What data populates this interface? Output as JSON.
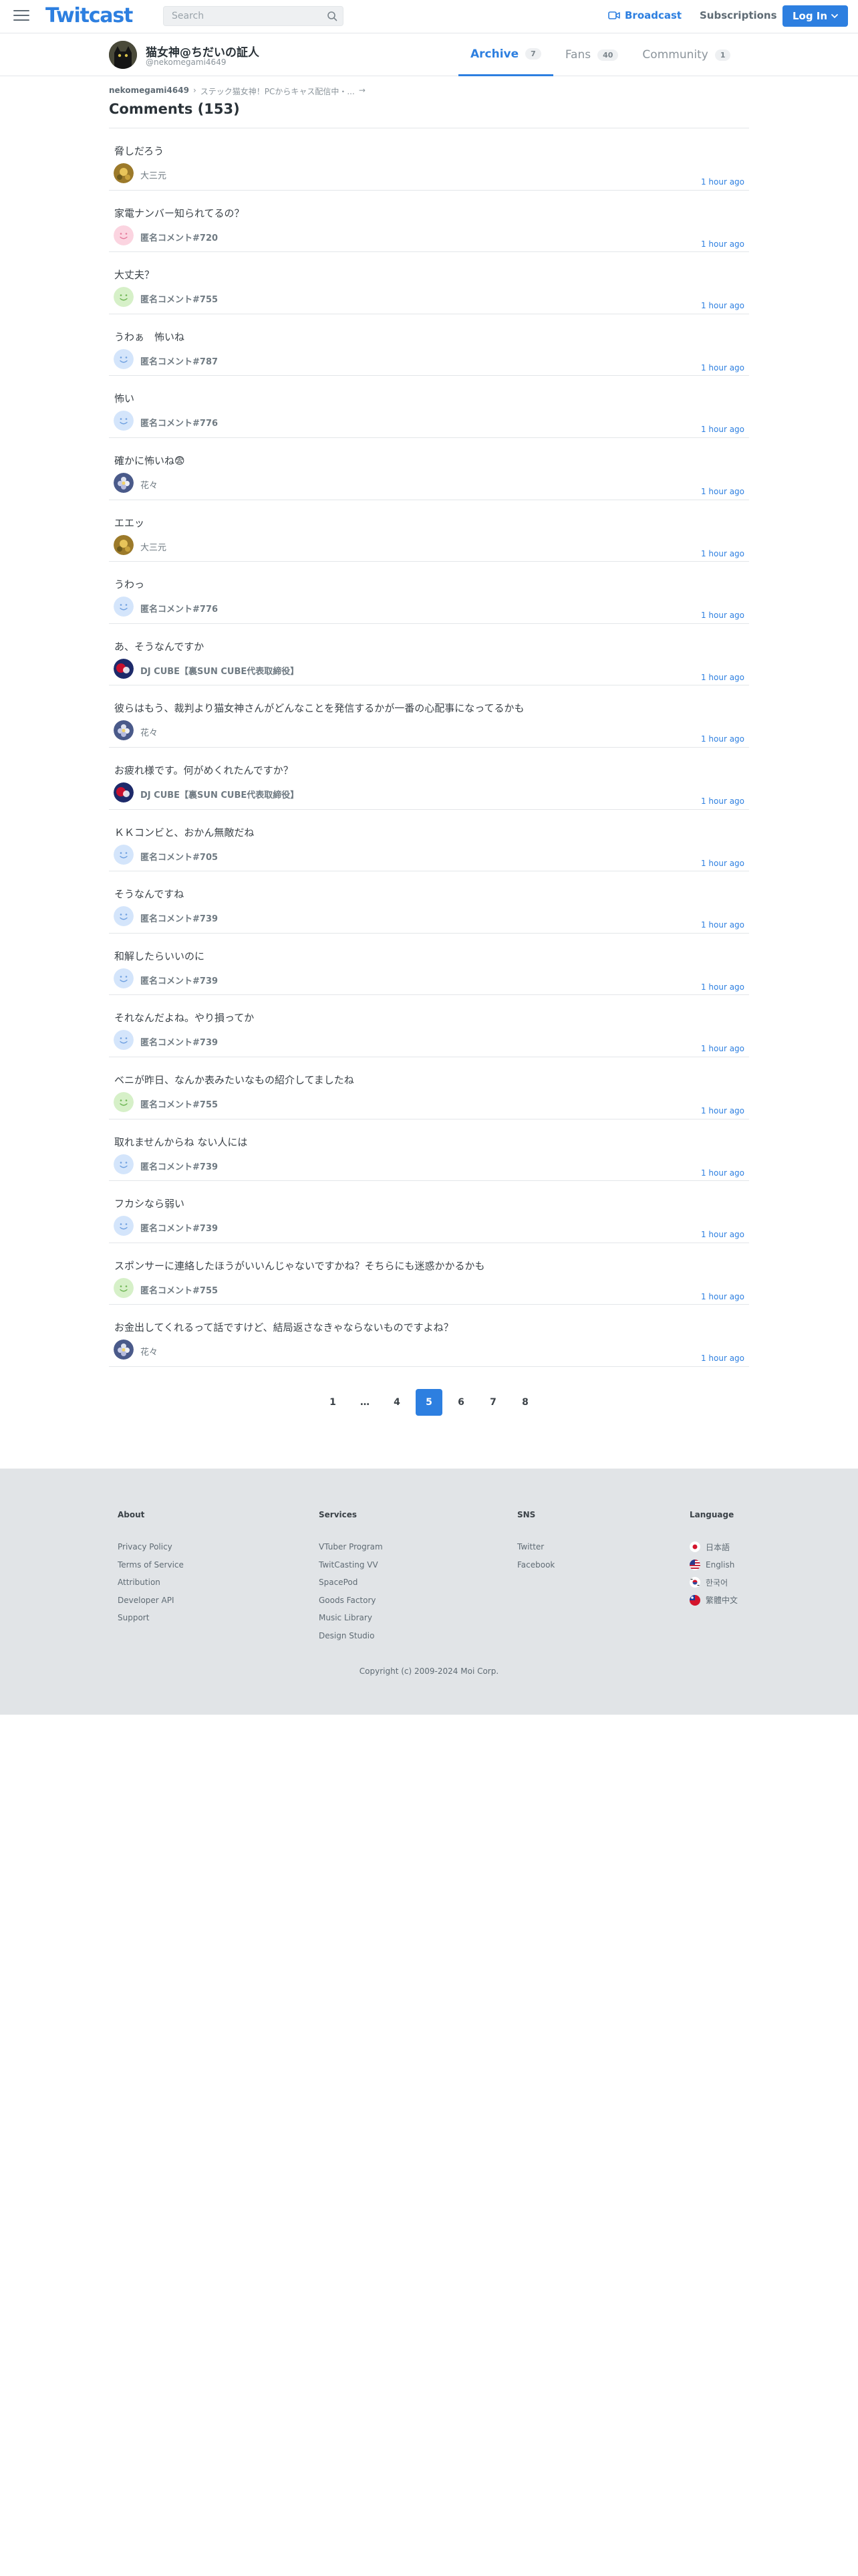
{
  "header": {
    "logo": "Twitcast",
    "search_placeholder": "Search",
    "broadcast_label": "Broadcast",
    "subscriptions_label": "Subscriptions",
    "login_label": "Log In"
  },
  "user": {
    "name": "猫女神@ちだいの証人",
    "id": "@nekomegami4649",
    "tabs": [
      {
        "label": "Archive",
        "count": "7",
        "active": true
      },
      {
        "label": "Fans",
        "count": "40",
        "active": false
      },
      {
        "label": "Community",
        "count": "1",
        "active": false
      }
    ]
  },
  "breadcrumb": {
    "first": "nekomegami4649",
    "second": "ステック猫女神！PCからキャス配信中・...",
    "sep": "›",
    "arrow": "→"
  },
  "heading": "Comments (153)",
  "comments": [
    {
      "text": "脅しだろう",
      "user": "大三元",
      "avatar": "gold",
      "time": "1 hour ago"
    },
    {
      "text": "家電ナンバー知られてるの？",
      "user": "匿名コメント#720",
      "avatar": "pink",
      "time": "1 hour ago"
    },
    {
      "text": "大丈夫？",
      "user": "匿名コメント#755",
      "avatar": "green",
      "time": "1 hour ago"
    },
    {
      "text": "うわぁ　怖いね",
      "user": "匿名コメント#787",
      "avatar": "blue",
      "time": "1 hour ago"
    },
    {
      "text": "怖い　",
      "user": "匿名コメント#776",
      "avatar": "blue",
      "time": "1 hour ago"
    },
    {
      "text": "確かに怖いね😨",
      "user": "花々",
      "avatar": "flower",
      "time": "1 hour ago"
    },
    {
      "text": "エエッ",
      "user": "大三元",
      "avatar": "gold",
      "time": "1 hour ago"
    },
    {
      "text": "うわっ　",
      "user": "匿名コメント#776",
      "avatar": "blue",
      "time": "1 hour ago"
    },
    {
      "text": "あ、そうなんですか",
      "user": "DJ CUBE【裏SUN CUBE代表取締役】",
      "avatar": "cube",
      "time": "1 hour ago"
    },
    {
      "text": "彼らはもう、裁判より猫女神さんがどんなことを発信するかが一番の心配事になってるかも",
      "user": "花々",
      "avatar": "flower",
      "time": "1 hour ago"
    },
    {
      "text": "お疲れ様です。何がめくれたんですか？",
      "user": "DJ CUBE【裏SUN CUBE代表取締役】",
      "avatar": "cube",
      "time": "1 hour ago"
    },
    {
      "text": "ＫＫコンビと、おかん無敵だね",
      "user": "匿名コメント#705",
      "avatar": "blue",
      "time": "1 hour ago"
    },
    {
      "text": "そうなんですね",
      "user": "匿名コメント#739",
      "avatar": "blue",
      "time": "1 hour ago"
    },
    {
      "text": "和解したらいいのに",
      "user": "匿名コメント#739",
      "avatar": "blue",
      "time": "1 hour ago"
    },
    {
      "text": "それなんだよね。やり損ってか",
      "user": "匿名コメント#739",
      "avatar": "blue",
      "time": "1 hour ago"
    },
    {
      "text": "ベニが昨日、なんか表みたいなもの紹介してましたね",
      "user": "匿名コメント#755",
      "avatar": "green",
      "time": "1 hour ago"
    },
    {
      "text": "取れませんからね ない人には",
      "user": "匿名コメント#739",
      "avatar": "blue",
      "time": "1 hour ago"
    },
    {
      "text": "フカシなら弱い",
      "user": "匿名コメント#739",
      "avatar": "blue",
      "time": "1 hour ago"
    },
    {
      "text": "スポンサーに連絡したほうがいいんじゃないですかね？そちらにも迷惑かかるかも",
      "user": "匿名コメント#755",
      "avatar": "green",
      "time": "1 hour ago"
    },
    {
      "text": "お金出してくれるって話ですけど、結局返さなきゃならないものですよね？",
      "user": "花々",
      "avatar": "flower",
      "time": "1 hour ago"
    }
  ],
  "pagination": [
    {
      "label": "1",
      "active": false
    },
    {
      "label": "…",
      "active": false
    },
    {
      "label": "4",
      "active": false
    },
    {
      "label": "5",
      "active": true
    },
    {
      "label": "6",
      "active": false
    },
    {
      "label": "7",
      "active": false
    },
    {
      "label": "8",
      "active": false
    }
  ],
  "footer": {
    "about": {
      "heading": "About",
      "links": [
        "Privacy Policy",
        "Terms of Service",
        "Attribution",
        "Developer API",
        "Support"
      ]
    },
    "services": {
      "heading": "Services",
      "links": [
        "VTuber Program",
        "TwitCasting VV",
        "SpacePod",
        "Goods Factory",
        "Music Library",
        "Design Studio"
      ]
    },
    "sns": {
      "heading": "SNS",
      "links": [
        "Twitter",
        "Facebook"
      ]
    },
    "language": {
      "heading": "Language",
      "links": [
        {
          "label": "日本語",
          "flag": "jp-flag-icon"
        },
        {
          "label": "English",
          "flag": "us-flag-icon"
        },
        {
          "label": "한국어",
          "flag": "kr-flag-icon"
        },
        {
          "label": "繁體中文",
          "flag": "tw-flag-icon"
        }
      ]
    },
    "copyright": "Copyright (c) 2009-2024 Moi Corp."
  },
  "colors": {
    "accent": "#2d7fe0",
    "footer_bg": "#e1e4e7"
  }
}
